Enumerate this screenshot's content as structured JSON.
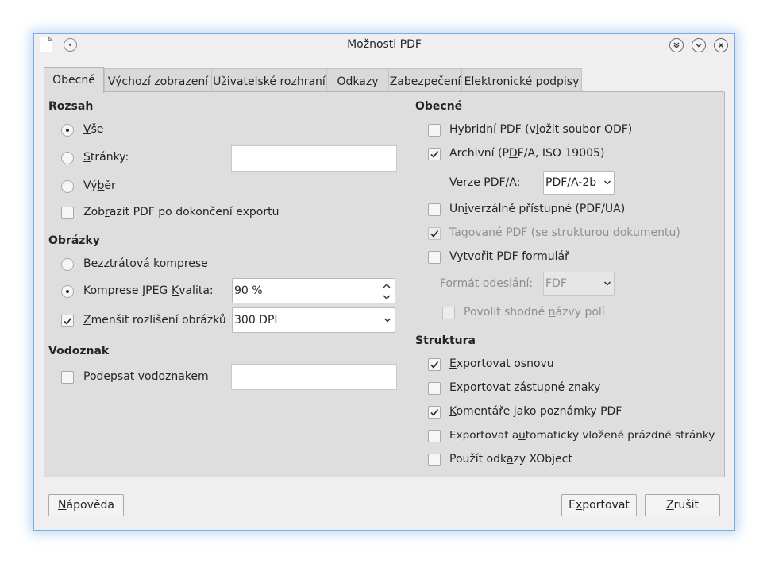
{
  "window": {
    "title": "Možnosti PDF"
  },
  "tabs": [
    {
      "label": "Obecné",
      "active": true
    },
    {
      "label": "Výchozí zobrazení"
    },
    {
      "label": "Uživatelské rozhraní"
    },
    {
      "label": "Odkazy"
    },
    {
      "label": "Zabezpečení"
    },
    {
      "label": "Elektronické podpisy"
    }
  ],
  "left": {
    "range": {
      "header": "Rozsah",
      "all": {
        "pre": "",
        "key": "V",
        "post": "še",
        "selected": true
      },
      "pages": {
        "pre": "",
        "key": "S",
        "post": "tránky:",
        "selected": false,
        "value": ""
      },
      "selection": {
        "pre": "Vý",
        "key": "b",
        "post": "ěr",
        "selected": false
      },
      "show_pdf": {
        "pre": "Zob",
        "key": "r",
        "post": "azit PDF po dokončení exportu",
        "checked": false
      }
    },
    "images": {
      "header": "Obrázky",
      "lossless": {
        "pre": "Bezztrát",
        "key": "o",
        "post": "vá komprese",
        "selected": false
      },
      "jpeg": {
        "pre": "Komprese ",
        "key": "J",
        "post": "PEG",
        "selected": true
      },
      "quality": {
        "pre": "",
        "key": "K",
        "post": "valita:",
        "value": "90 %"
      },
      "reduce": {
        "pre": "",
        "key": "Z",
        "post": "menšit rozlišení obrázků",
        "checked": true,
        "value": "300 DPI"
      }
    },
    "watermark": {
      "header": "Vodoznak",
      "sign": {
        "pre": "Po",
        "key": "d",
        "post": "epsat vodoznakem",
        "checked": false,
        "value": ""
      }
    }
  },
  "right": {
    "general": {
      "header": "Obecné",
      "hybrid": {
        "pre": "Hybridní PDF (v",
        "key": "l",
        "post": "ožit soubor ODF)",
        "checked": false
      },
      "archive": {
        "pre": "Archivní (P",
        "key": "D",
        "post": "F/A, ISO 19005)",
        "checked": true
      },
      "pdfa_version": {
        "pre": "Verze P",
        "key": "D",
        "post": "F/A:",
        "value": "PDF/A-2b"
      },
      "universal": {
        "pre": "Un",
        "key": "i",
        "post": "verzálně přístupné (PDF/UA)",
        "checked": false
      },
      "tagged": {
        "pre": "Tagované PDF (se strukturou dokumentu)",
        "key": "",
        "post": "",
        "checked": true,
        "disabled": true
      },
      "form": {
        "pre": "Vytvořit PDF ",
        "key": "f",
        "post": "ormulář",
        "checked": false
      },
      "submit_format": {
        "pre": "For",
        "key": "m",
        "post": "át odeslání:",
        "value": "FDF",
        "disabled": true
      },
      "duplicate_names": {
        "pre": "Povolit shodné ",
        "key": "n",
        "post": "ázvy polí",
        "checked": false,
        "disabled": true
      }
    },
    "structure": {
      "header": "Struktura",
      "outline": {
        "pre": "",
        "key": "E",
        "post": "xportovat osnovu",
        "checked": true
      },
      "placeholders": {
        "pre": "Exportovat zás",
        "key": "t",
        "post": "upné znaky",
        "checked": false
      },
      "comments": {
        "pre": "",
        "key": "K",
        "post": "omentáře jako poznámky PDF",
        "checked": true
      },
      "blank_pages": {
        "pre": "Exportovat a",
        "key": "u",
        "post": "tomaticky vložené prázdné stránky",
        "checked": false
      },
      "xobject": {
        "pre": "Použít odk",
        "key": "a",
        "post": "zy XObject",
        "checked": false
      }
    }
  },
  "buttons": {
    "help": {
      "pre": "",
      "key": "N",
      "post": "ápověda"
    },
    "export": {
      "pre": "E",
      "key": "x",
      "post": "portovat"
    },
    "cancel": {
      "pre": "",
      "key": "Z",
      "post": "rušit"
    }
  }
}
